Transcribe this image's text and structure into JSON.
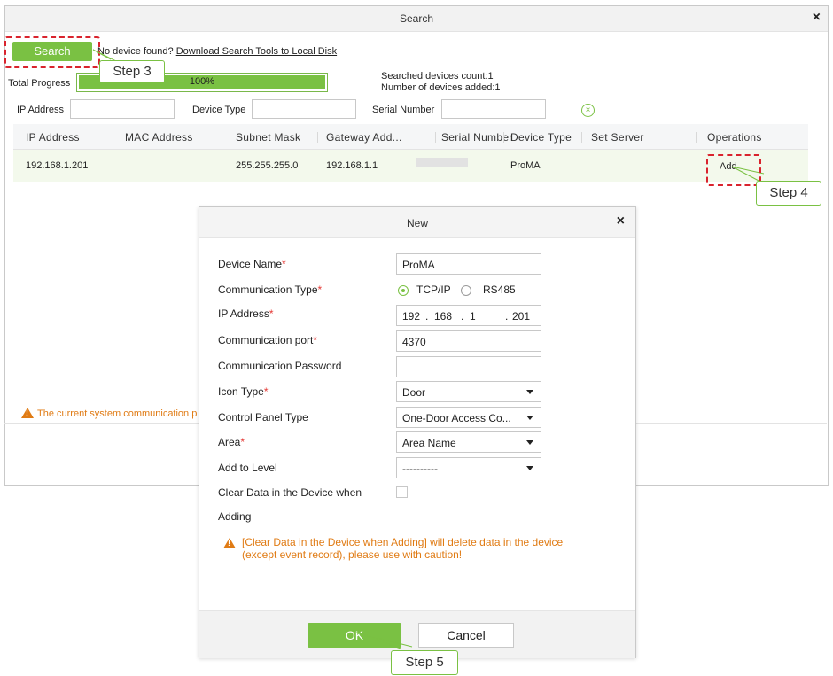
{
  "search_window": {
    "title": "Search",
    "close_glyph": "×",
    "search_button": "Search",
    "no_device_text": "No device found?",
    "download_link": "Download Search Tools to Local Disk",
    "total_progress_label": "Total Progress",
    "progress_percent": 100,
    "progress_text": "100%",
    "searched_count": "Searched devices count:1",
    "added_count": "Number of devices added:1",
    "filters": {
      "ip_label": "IP Address",
      "device_type_label": "Device Type",
      "serial_label": "Serial Number",
      "clear_glyph": "×"
    },
    "table": {
      "headers": [
        "IP Address",
        "MAC Address",
        "Subnet Mask",
        "Gateway Add...",
        "Serial Number",
        "Device Type",
        "Set Server",
        "Operations"
      ],
      "rows": [
        {
          "ip": "192.168.1.201",
          "mac": "",
          "subnet": "255.255.255.0",
          "gateway": "192.168.1.1",
          "serial": "",
          "device_type": "ProMA",
          "set_server": "",
          "operation": "Add"
        }
      ]
    },
    "bottom_warning": "The current system communication p"
  },
  "new_dialog": {
    "title": "New",
    "close_glyph": "×",
    "fields": {
      "device_name_label": "Device Name",
      "device_name_value": "ProMA",
      "comm_type_label": "Communication Type",
      "comm_type_options": [
        "TCP/IP",
        "RS485"
      ],
      "comm_type_selected": "TCP/IP",
      "ip_label": "IP Address",
      "ip_parts": [
        "192",
        "168",
        "1",
        "201"
      ],
      "port_label": "Communication port",
      "port_value": "4370",
      "password_label": "Communication Password",
      "password_value": "",
      "icon_type_label": "Icon Type",
      "icon_type_value": "Door",
      "panel_type_label": "Control Panel Type",
      "panel_type_value": "One-Door Access Co...",
      "area_label": "Area",
      "area_value": "Area Name",
      "level_label": "Add to Level",
      "level_value": "----------",
      "clear_data_label_1": "Clear Data in the Device when",
      "clear_data_label_2": "Adding",
      "required_mark": "*"
    },
    "warning_line1": "[Clear Data in the Device when Adding] will delete data in the device",
    "warning_line2": "(except event record), please use with caution!",
    "ok_label": "OK",
    "cancel_label": "Cancel"
  },
  "steps": {
    "step3": "Step 3",
    "step4": "Step 4",
    "step5": "Step 5"
  },
  "colors": {
    "accent_green": "#7ac143",
    "warning_orange": "#e07b14",
    "callout_red": "#d9232d",
    "required_red": "#e53935"
  }
}
